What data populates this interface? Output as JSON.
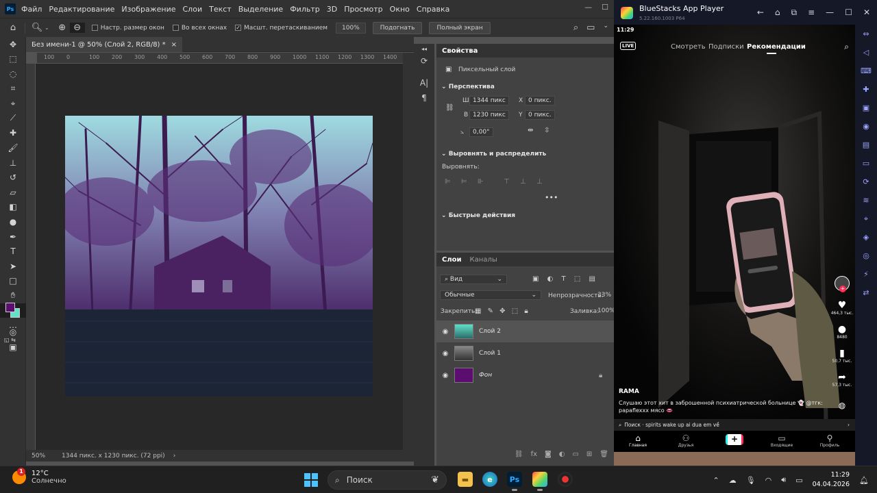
{
  "photoshop": {
    "menu": [
      "Файл",
      "Редактирование",
      "Изображение",
      "Слои",
      "Текст",
      "Выделение",
      "Фильтр",
      "3D",
      "Просмотр",
      "Окно",
      "Справка"
    ],
    "options": {
      "fit_window": "Настр. размер окон",
      "all_windows": "Во всех окнах",
      "scrubby_zoom": "Масшт. перетаскиванием",
      "zoom_value": "100%",
      "fit_button": "Подогнать",
      "fullscreen_button": "Полный экран"
    },
    "document": {
      "tab_title": "Без имени-1 @ 50% (Слой 2, RGB/8) *",
      "ruler_ticks": [
        "100",
        "0",
        "100",
        "200",
        "300",
        "400",
        "500",
        "600",
        "700",
        "800",
        "900",
        "1000",
        "1100",
        "1200",
        "1300",
        "1400"
      ],
      "status_zoom": "50%",
      "status_info": "1344 пикс. x 1230 пикс. (72 ppi)"
    },
    "properties": {
      "tabs": [
        "Свойства"
      ],
      "layer_type": "Пиксельный слой",
      "transform_section": "Перспектива",
      "w_label": "Ш",
      "w_value": "1344 пикс",
      "h_label": "В",
      "h_value": "1230 пикс",
      "x_label": "X",
      "x_value": "0 пикс.",
      "y_label": "Y",
      "y_value": "0 пикс.",
      "angle_value": "0,00°",
      "align_section": "Выровнять и распределить",
      "align_label": "Выровнять:",
      "quick_actions": "Быстрые действия"
    },
    "layers_panel": {
      "tabs": [
        "Слои",
        "Каналы"
      ],
      "filter_kind": "Вид",
      "blend_mode": "Обычные",
      "opacity_label": "Непрозрачность:",
      "opacity_value": "33%",
      "lock_label": "Закрепить:",
      "fill_label": "Заливка:",
      "fill_value": "100%",
      "layers": [
        {
          "name": "Слой 2",
          "selected": true,
          "visible": true
        },
        {
          "name": "Слой 1",
          "selected": false,
          "visible": true
        },
        {
          "name": "Фон",
          "selected": false,
          "visible": true,
          "locked": true
        }
      ]
    },
    "colors": {
      "foreground": "#5b0e6f",
      "background": "#62e2c8"
    }
  },
  "bluestacks": {
    "title": "BlueStacks App Player",
    "version": "5.22.160.1003  P64",
    "phone": {
      "time": "11:29",
      "feed_tabs": [
        "Смотреть",
        "Подписки",
        "Рекомендации"
      ],
      "active_tab": "Рекомендации",
      "counts": {
        "likes": "464,3 тыс.",
        "comments": "8480",
        "saves": "50,7 тыс.",
        "shares": "57,3 тыс."
      },
      "username": "RAMA",
      "caption": "Слушаю этот хит в заброшенной психиатрической больнице 👻 @тгк: papaflexxx мясо 👄",
      "search_hint": "Поиск · spirits wake up ai dua em về",
      "nav": [
        "Главная",
        "Друзья",
        "",
        "Входящие",
        "Профиль"
      ]
    }
  },
  "taskbar": {
    "weather_temp": "12°C",
    "weather_desc": "Солнечно",
    "weather_badge": "1",
    "search_placeholder": "Поиск",
    "time": "11:29",
    "date": "04.04.2026"
  }
}
